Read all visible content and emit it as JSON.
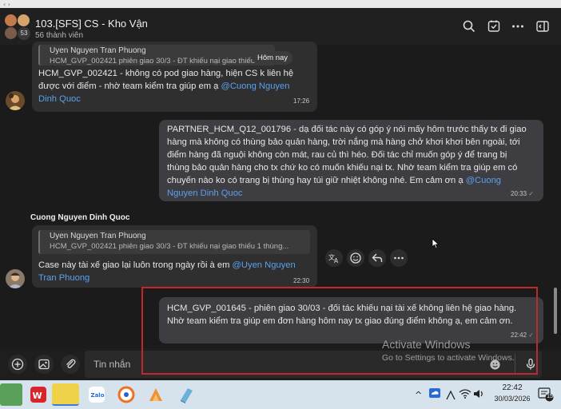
{
  "header": {
    "title": "103.[SFS] CS - Kho Vận",
    "members": "56 thành viên",
    "avatar_count": "53"
  },
  "chat": {
    "date_pill": "Hôm nay",
    "msg1": {
      "quote_name": "Uyen Nguyen Tran Phuong",
      "quote_text": "HCM_GVP_002421 phiên giao 30/3 - ĐT khiếu nại giao thiếu",
      "line1": "HCM_GVP_002421 - không có pod giao hàng, hiện CS k liên hệ",
      "line2_text": "được với điểm - nhờ team kiểm tra giúp em ạ ",
      "line2_mention": "@Cuong Nguyen",
      "line3_mention": "Dinh Quoc",
      "time": "17:26"
    },
    "msg2": {
      "line1": "PARTNER_HCM_Q12_001796  - dạ đối tác này có góp ý nói mấy hôm trước thấy tx đi giao",
      "line2": "hàng mà không có thùng bảo quản hàng, trời nắng mà hàng chở khơi khơi bên ngoài, tới",
      "line3": "điểm hàng đã nguội không còn mát, rau củ thì héo. Đối tác chỉ muốn góp ý để trang bị",
      "line4": "thùng bảo quản hàng cho tx chứ ko có muốn khiếu nại tx. Nhờ team kiểm tra giúp em có",
      "line5_text": "chuyến nào ko có trang bị thùng hay túi giữ nhiệt không nhé. Em cảm ơn ạ ",
      "line5_mention": "@Cuong",
      "line6_mention": "Nguyen Dinh Quoc",
      "time": "20:33",
      "status": "✓"
    },
    "sender_name": "Cuong Nguyen Dinh Quoc",
    "msg3": {
      "quote_name": "Uyen Nguyen Tran Phuong",
      "quote_text": "HCM_GVP_002421 phiên giao 30/3 - ĐT khiếu nại giao thiếu 1 thùng...",
      "line1_text": "Case này tài xế giao lại luôn trong ngày rồi à em ",
      "line1_mention": "@Uyen Nguyen",
      "line2_mention": "Tran Phuong",
      "time": "22:30"
    },
    "msg4": {
      "line1": "HCM_GVP_001645 - phiên giao 30/03 - đối tác khiếu nại tài xế không liên hệ giao hàng.",
      "line2": "Nhờ team kiểm tra giúp em đơn hàng hôm nay tx giao đúng điểm không ạ, em cảm ơn.",
      "time": "22:42",
      "status": "✓"
    }
  },
  "composer": {
    "placeholder": "Tin nhắn"
  },
  "watermark": {
    "line1": "Activate Windows",
    "line2": "Go to Settings to activate Windows."
  },
  "taskbar": {
    "time": "22:42",
    "date": "30/03/2026",
    "notif_count": "15",
    "zalo_label": "Zalo"
  },
  "colors": {
    "accent_mention": "#5aa1f0",
    "highlight_box": "#c0282b"
  }
}
